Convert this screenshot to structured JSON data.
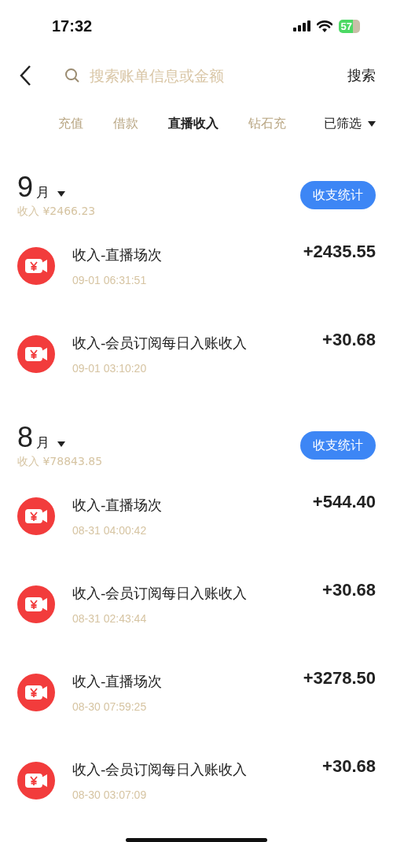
{
  "status_bar": {
    "time": "17:32",
    "battery": "57"
  },
  "search": {
    "placeholder": "搜索账单信息或金额",
    "button": "搜索"
  },
  "tabs": [
    {
      "label": "充值",
      "selected": false
    },
    {
      "label": "借款",
      "selected": false
    },
    {
      "label": "直播收入",
      "selected": true
    },
    {
      "label": "钻石充",
      "selected": false
    }
  ],
  "filter": {
    "label": "已筛选"
  },
  "months": [
    {
      "month": "9",
      "unit": "月",
      "summary": "收入 ¥2466.23",
      "stats_button": "收支统计",
      "items": [
        {
          "title": "收入-直播场次",
          "time": "09-01 06:31:51",
          "amount": "+2435.55"
        },
        {
          "title": "收入-会员订阅每日入账收入",
          "time": "09-01 03:10:20",
          "amount": "+30.68"
        }
      ]
    },
    {
      "month": "8",
      "unit": "月",
      "summary": "收入 ¥78843.85",
      "stats_button": "收支统计",
      "items": [
        {
          "title": "收入-直播场次",
          "time": "08-31 04:00:42",
          "amount": "+544.40"
        },
        {
          "title": "收入-会员订阅每日入账收入",
          "time": "08-31 02:43:44",
          "amount": "+30.68"
        },
        {
          "title": "收入-直播场次",
          "time": "08-30 07:59:25",
          "amount": "+3278.50"
        },
        {
          "title": "收入-会员订阅每日入账收入",
          "time": "08-30 03:07:09",
          "amount": "+30.68"
        }
      ]
    }
  ]
}
